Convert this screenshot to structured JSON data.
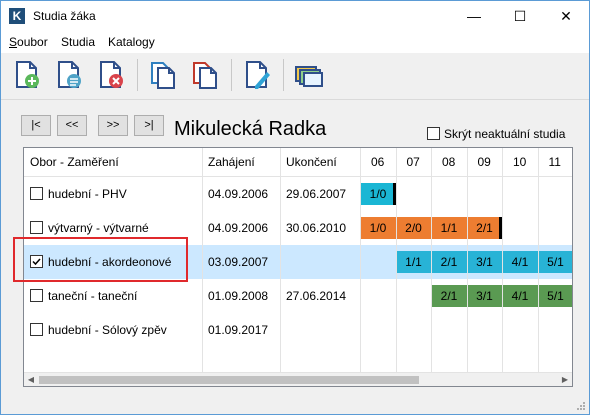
{
  "window": {
    "title": "Studia žáka",
    "minimize_glyph": "—",
    "maximize_glyph": "☐",
    "close_glyph": "✕",
    "app_icon_letter": "K"
  },
  "menu": {
    "items": [
      {
        "accel": "S",
        "rest": "oubor"
      },
      {
        "accel": "",
        "rest": "Studia"
      },
      {
        "accel": "",
        "rest": "Katalogy"
      }
    ]
  },
  "toolbar": {
    "icons": [
      "doc-add-icon",
      "doc-details-icon",
      "doc-delete-icon",
      "doc-copy-blue-icon",
      "doc-copy-red-icon",
      "doc-edit-icon",
      "layers-icon"
    ]
  },
  "nav": {
    "first": "|<",
    "prev": "<<",
    "next": ">>",
    "last": ">|"
  },
  "student_name": "Mikulecká Radka",
  "hide_outdated": {
    "label": "Skrýt neaktuální studia",
    "checked": false
  },
  "columns": {
    "field": "Obor - Zaměření",
    "start": "Zahájení",
    "end": "Ukončení",
    "years": [
      "06",
      "07",
      "08",
      "09",
      "10",
      "11"
    ]
  },
  "rows": [
    {
      "field": "hudební - PHV",
      "start": "04.09.2006",
      "end": "29.06.2007",
      "checked": false,
      "selected": false,
      "bars": [
        {
          "col": 0,
          "label": "1/0",
          "color": "cyan"
        }
      ],
      "endmark_after_col": 0
    },
    {
      "field": "výtvarný - výtvarné",
      "start": "04.09.2006",
      "end": "30.06.2010",
      "checked": false,
      "selected": false,
      "bars": [
        {
          "col": 0,
          "label": "1/0",
          "color": "orange"
        },
        {
          "col": 1,
          "label": "2/0",
          "color": "orange"
        },
        {
          "col": 2,
          "label": "1/1",
          "color": "orange"
        },
        {
          "col": 3,
          "label": "2/1",
          "color": "orange"
        }
      ],
      "endmark_after_col": 3
    },
    {
      "field": "hudební - akordeonové",
      "start": "03.09.2007",
      "end": "",
      "checked": true,
      "selected": true,
      "bars": [
        {
          "col": 1,
          "label": "1/1",
          "color": "blue"
        },
        {
          "col": 2,
          "label": "2/1",
          "color": "blue"
        },
        {
          "col": 3,
          "label": "3/1",
          "color": "blue"
        },
        {
          "col": 4,
          "label": "4/1",
          "color": "blue"
        },
        {
          "col": 5,
          "label": "5/1",
          "color": "blue"
        }
      ],
      "endmark_after_col": null
    },
    {
      "field": "taneční - taneční",
      "start": "01.09.2008",
      "end": "27.06.2014",
      "checked": false,
      "selected": false,
      "bars": [
        {
          "col": 2,
          "label": "2/1",
          "color": "green"
        },
        {
          "col": 3,
          "label": "3/1",
          "color": "green"
        },
        {
          "col": 4,
          "label": "4/1",
          "color": "green"
        },
        {
          "col": 5,
          "label": "5/1",
          "color": "green"
        }
      ],
      "endmark_after_col": null
    },
    {
      "field": "hudební - Sólový zpěv",
      "start": "01.09.2017",
      "end": "",
      "checked": false,
      "selected": false,
      "bars": [],
      "endmark_after_col": null
    }
  ],
  "colors": {
    "cyan": "#1ab6d4",
    "orange": "#ed7d31",
    "blue": "#28b3d6",
    "green": "#5a9a52",
    "highlight": "#e0292c",
    "selection": "#cce8ff"
  }
}
